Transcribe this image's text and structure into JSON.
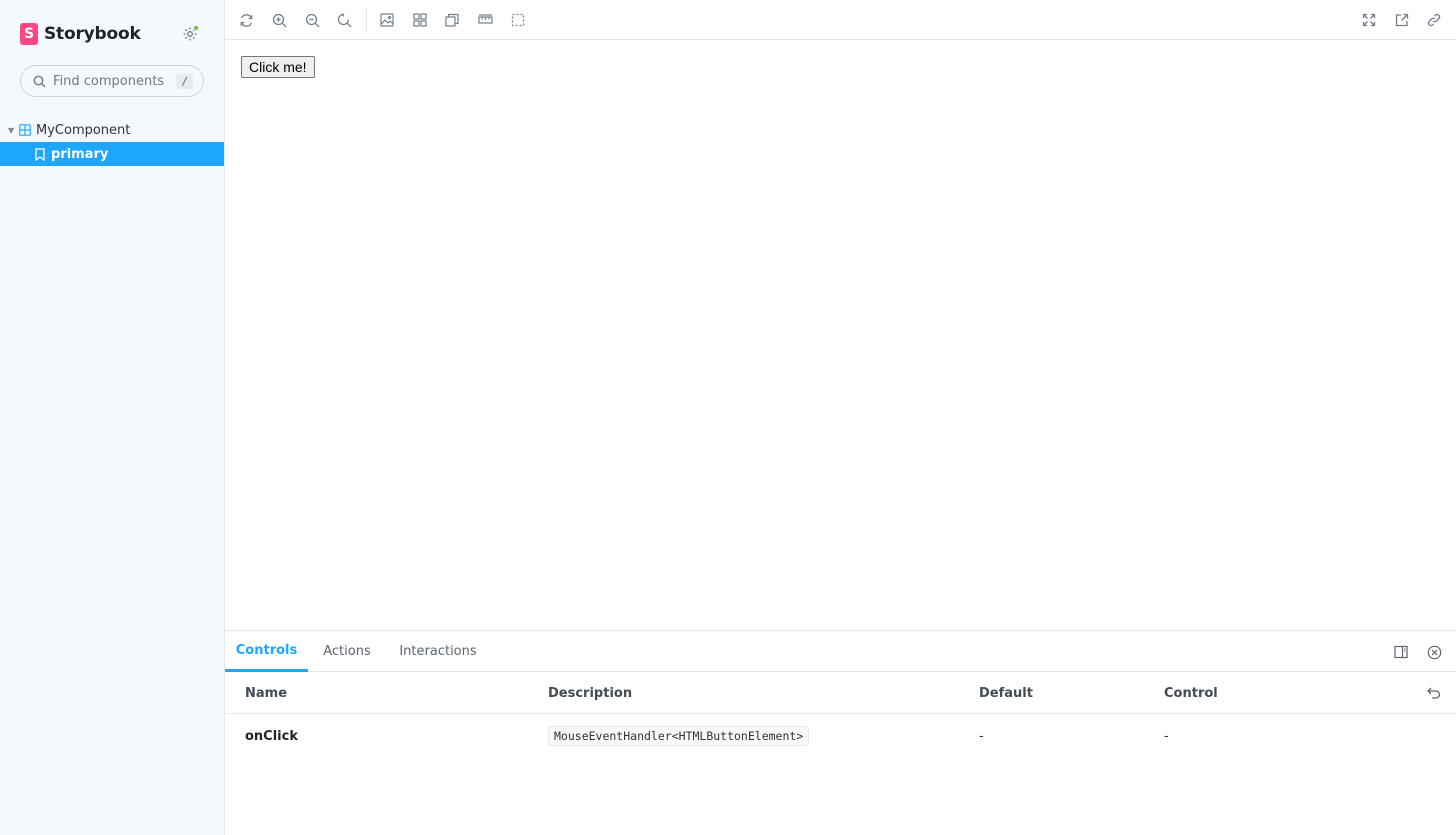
{
  "sidebar": {
    "brand": {
      "logo_letter": "S",
      "name": "Storybook"
    },
    "search": {
      "placeholder": "Find components",
      "shortcut": "/"
    },
    "tree": {
      "group_label": "MyComponent",
      "items": [
        {
          "label": "primary",
          "selected": true
        }
      ]
    }
  },
  "toolbar": {
    "left_icons": [
      "refresh-icon",
      "zoom-in-icon",
      "zoom-out-icon",
      "zoom-reset-icon",
      "background-icon",
      "grid-icon",
      "viewport-icon",
      "measure-icon",
      "outline-icon"
    ],
    "right_icons": [
      "fullscreen-icon",
      "open-new-tab-icon",
      "copy-link-icon"
    ]
  },
  "preview": {
    "button_label": "Click me!"
  },
  "panel": {
    "tabs": [
      {
        "label": "Controls",
        "active": true
      },
      {
        "label": "Actions",
        "active": false
      },
      {
        "label": "Interactions",
        "active": false
      }
    ],
    "table": {
      "headers": {
        "name": "Name",
        "description": "Description",
        "default": "Default",
        "control": "Control"
      },
      "rows": [
        {
          "name": "onClick",
          "description": "MouseEventHandler<HTMLButtonElement>",
          "default": "-",
          "control": "-"
        }
      ]
    }
  },
  "colors": {
    "accent": "#1ea7fd",
    "brand": "#ff4785",
    "status_dot": "#66bf3c",
    "sidebar_bg": "#f6f9fc"
  }
}
